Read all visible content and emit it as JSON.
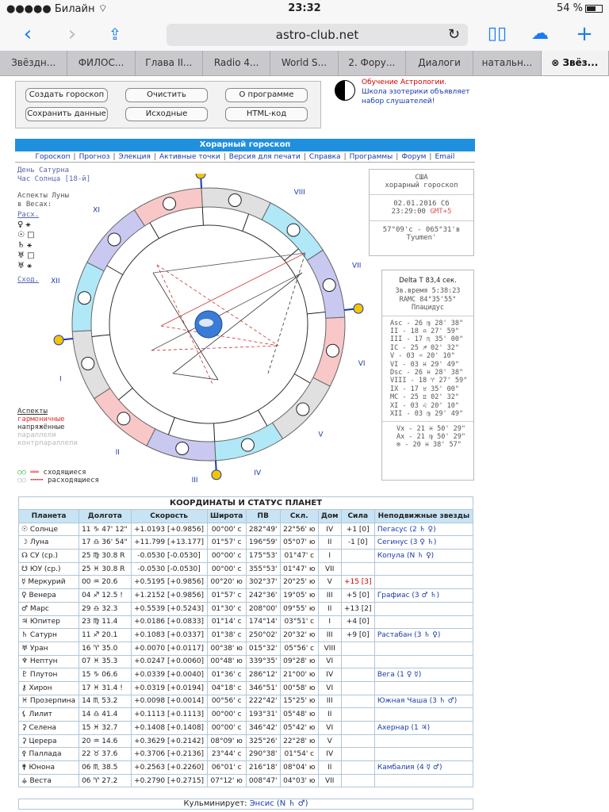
{
  "status": {
    "carrier": "Билайн",
    "time": "23:32",
    "battery": "54 %"
  },
  "browser": {
    "url": "astro-club.net",
    "tabs": [
      "Звёздн...",
      "ФИЛОС...",
      "Глава II...",
      "Radio 4...",
      "World S...",
      "2. Фору...",
      "Диалоги",
      "натальн...",
      "Звёз..."
    ]
  },
  "buttons": {
    "create": "Создать гороскоп",
    "clear": "Очистить",
    "about": "О программе",
    "save": "Сохранить данные",
    "source": "Исходные",
    "html": "HTML-код"
  },
  "promo": {
    "line1": "Обучение Астрологии.",
    "line2": "Школа эзотерики объявляет",
    "line3": "набор слушателей!"
  },
  "horary": {
    "title": "Хорарный гороскоп",
    "menu": [
      "Гороскоп",
      "Прогноз",
      "Элекция",
      "Активные точки",
      "Версия для печати",
      "Справка",
      "Программы",
      "Форум",
      "Email"
    ]
  },
  "leftinfo": {
    "day": "День Сатурна",
    "hour": "Час Солнца [18-й]",
    "aspects1": "Аспекты Луны",
    "aspects2": "в Весах:",
    "diverg": "Расх.",
    "converg": "Сход.",
    "diverg_glyphs": [
      "♀ ⚹",
      "☉ □",
      "♄ ⚹",
      "♅ □",
      "♅ ⚹"
    ],
    "legend_title": "Аспекты",
    "legend_harm": "гармоничные",
    "legend_tense": "напряжённые",
    "legend_par": "параллели",
    "legend_cpar": "контрпараллели",
    "legend_conv": "сходящиеся",
    "legend_div": "расходящиеся"
  },
  "infobox1": {
    "country": "США",
    "type": "хорарный гороскоп",
    "date": "02.01.2016 Сб",
    "time": "23:29:00",
    "gmt": "GMT+5",
    "coords": "57°09'с - 065°31'в",
    "city": "Tyumen'"
  },
  "infobox2": {
    "delta": "Delta T  83,4 сек.",
    "star": "Зв.время 5:38:23",
    "ramc": "RAMC 84°35'55\"",
    "system": "Плацидус",
    "cusps": [
      "Asc - 26 ♍ 28' 38\"",
      "II - 18 ♎ 27' 59\"",
      "III - 17 ♏ 35' 00\"",
      "IC - 25 ♐ 02' 32\"",
      "V - 03 ♒ 20' 10\"",
      "VI - 03 ♓ 29' 49\"",
      "Dsc - 26 ♓ 28' 38\"",
      "VIII - 18 ♈ 27' 59\"",
      "IX - 17 ♉ 35' 00\"",
      "MC - 25 ♊ 02' 32\"",
      "XI - 03 ♌ 20' 10\"",
      "XII - 03 ♍ 29' 49\""
    ],
    "vx": "Vx - 21 ♓ 50' 29\"",
    "ax": "Ax - 21 ♍ 50' 29\"",
    "pf": "⊗ - 20 ♓ 38' 57\""
  },
  "table": {
    "title": "КООРДИНАТЫ И СТАТУС ПЛАНЕТ",
    "headers": [
      "Планета",
      "Долгота",
      "Скорость",
      "Широта",
      "ПВ",
      "Скл.",
      "Дом",
      "Сила",
      "Неподвижные звезды"
    ],
    "rows": [
      [
        "☉ Солнце",
        "11 ♑ 47' 12\"",
        "+1.0193 [+0.9856]",
        "00°00' с",
        "282°49'",
        "22°56' ю",
        "IV",
        "+1 [0]",
        "Пегасус (2 ♄ ♀)"
      ],
      [
        "☽ Луна",
        "17 ♎ 36' 54\"",
        "+11.799 [+13.177]",
        "01°57' с",
        "196°59'",
        "05°07' ю",
        "II",
        "-1 [0]",
        "Сегинус (3 ♀ ♄)"
      ],
      [
        "☊ СУ (ср.)",
        "25 ♍ 30.8 R",
        "-0.0530 [-0.0530]",
        "00°00' с",
        "175°53'",
        "01°47' с",
        "I",
        "",
        "Копула (N ♄ ♀)"
      ],
      [
        "☋ ЮУ (ср.)",
        "25 ♓ 30.8 R",
        "-0.0530 [-0.0530]",
        "00°00' с",
        "355°53'",
        "01°47' ю",
        "VII",
        "",
        ""
      ],
      [
        "☿ Меркурий",
        "00 ♒ 20.6",
        "+0.5195 [+0.9856]",
        "00°20' ю",
        "302°37'",
        "20°25' ю",
        "V",
        "+15 [3]",
        ""
      ],
      [
        "♀ Венера",
        "04 ♐ 12.5 !",
        "+1.2152 [+0.9856]",
        "01°57' с",
        "242°36'",
        "19°05' ю",
        "III",
        "+5 [0]",
        "Графиас (3 ♂ ♄)"
      ],
      [
        "♂ Марс",
        "29 ♎ 32.3",
        "+0.5539 [+0.5243]",
        "01°30' с",
        "208°00'",
        "09°55' ю",
        "II",
        "+13 [2]",
        ""
      ],
      [
        "♃ Юпитер",
        "23 ♍ 11.4",
        "+0.0186 [+0.0833]",
        "01°14' с",
        "174°14'",
        "03°51' с",
        "I",
        "+4 [0]",
        ""
      ],
      [
        "♄ Сатурн",
        "11 ♐ 20.1",
        "+0.1083 [+0.0337]",
        "01°38' с",
        "250°02'",
        "20°32' ю",
        "III",
        "+9 [0]",
        "Растабан (3 ♄ ♀)"
      ],
      [
        "♅ Уран",
        "16 ♈ 35.0",
        "+0.0070 [+0.0117]",
        "00°38' ю",
        "015°32'",
        "05°56' с",
        "VIII",
        "",
        ""
      ],
      [
        "♆ Нептун",
        "07 ♓ 35.3",
        "+0.0247 [+0.0060]",
        "00°48' ю",
        "339°35'",
        "09°28' ю",
        "VI",
        "",
        ""
      ],
      [
        "♇ Плутон",
        "15 ♑ 06.6",
        "+0.0339 [+0.0040]",
        "01°36' с",
        "286°12'",
        "21°00' ю",
        "IV",
        "",
        "Вега (1 ♀ ☿)"
      ],
      [
        "⚷ Хирон",
        "17 ♓ 31.4 !",
        "+0.0319 [+0.0194]",
        "04°18' с",
        "346°51'",
        "00°58' ю",
        "VI",
        "",
        ""
      ],
      [
        "♓ Прозерпина",
        "14 ♏ 53.2",
        "+0.0098 [+0.0014]",
        "00°56' с",
        "222°42'",
        "15°25' ю",
        "III",
        "",
        "Южная Чаша (3 ♄ ♂)"
      ],
      [
        "⚸ Лилит",
        "14 ♎ 41.4",
        "+0.1113 [+0.1113]",
        "00°00' с",
        "193°31'",
        "05°48' ю",
        "II",
        "",
        ""
      ],
      [
        "⚳ Селена",
        "15 ♓ 32.7",
        "+0.1408 [+0.1408]",
        "00°00' с",
        "346°42'",
        "05°42' ю",
        "VI",
        "",
        "Ахернар (1 ♃)"
      ],
      [
        "⚳ Церера",
        "20 ♒ 14.6",
        "+0.3629 [+0.2142]",
        "08°09' ю",
        "325°26'",
        "22°28' ю",
        "V",
        "",
        ""
      ],
      [
        "⚴ Паллада",
        "22 ♉ 37.6",
        "+0.3706 [+0.2136]",
        "23°44' с",
        "290°38'",
        "01°54' с",
        "IV",
        "",
        ""
      ],
      [
        "⚵ Юнона",
        "06 ♏ 38.5",
        "+0.2563 [+0.2260]",
        "06°01' с",
        "216°18'",
        "08°04' ю",
        "II",
        "",
        "Камбалия (4 ☿ ♂)"
      ],
      [
        "⚶ Веста",
        "06 ♈ 27.2",
        "+0.2790 [+0.2715]",
        "07°12' ю",
        "008°47'",
        "04°03' ю",
        "VII",
        "",
        ""
      ]
    ]
  },
  "footer": {
    "label": "Кульминирует:",
    "star": "Энсис (N ♄ ♂)"
  }
}
